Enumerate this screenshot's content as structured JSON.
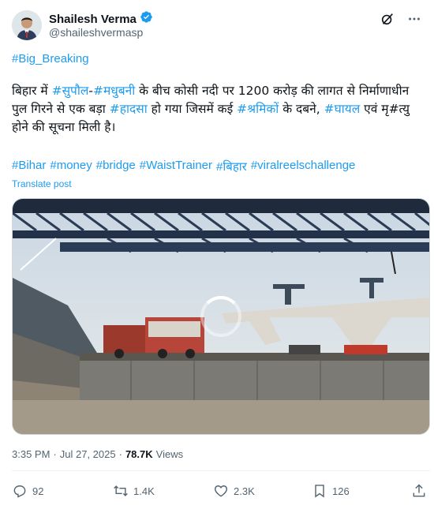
{
  "author": {
    "name": "Shailesh Verma",
    "handle": "@shaileshvermasp",
    "verified_color": "#1d9bf0"
  },
  "header": {
    "grok_icon": "grok-icon",
    "more_icon": "more-icon"
  },
  "post": {
    "top_hashtag": "#Big_Breaking",
    "text_parts": [
      {
        "t": "बिहार में ",
        "h": false
      },
      {
        "t": "#सुपौल",
        "h": true
      },
      {
        "t": "-",
        "h": false
      },
      {
        "t": "#मधुबनी",
        "h": true
      },
      {
        "t": " के बीच कोसी नदी पर 1200 करोड़ की लागत से निर्माणाधीन पुल गिरने से एक बड़ा ",
        "h": false
      },
      {
        "t": "#हादसा",
        "h": true
      },
      {
        "t": " हो गया जिसमें कई ",
        "h": false
      },
      {
        "t": "#श्रमिकों",
        "h": true
      },
      {
        "t": " के दबने, ",
        "h": false
      },
      {
        "t": "#घायल",
        "h": true
      },
      {
        "t": " एवं मृ#त्यु होने की सूचना मिली है।",
        "h": false
      }
    ],
    "tags": [
      "#Bihar",
      "#money",
      "#bridge",
      "#WaistTrainer",
      "#बिहार",
      "#viralreelschallenge"
    ],
    "translate_label": "Translate post"
  },
  "meta": {
    "time": "3:35 PM",
    "separator": "·",
    "date": "Jul 27, 2025",
    "views_count": "78.7K",
    "views_label": "Views"
  },
  "actions": {
    "replies": "92",
    "reposts": "1.4K",
    "likes": "2.3K",
    "bookmarks": "126"
  },
  "colors": {
    "accent": "#1d9bf0",
    "secondary": "#536471",
    "text": "#0f1419"
  }
}
